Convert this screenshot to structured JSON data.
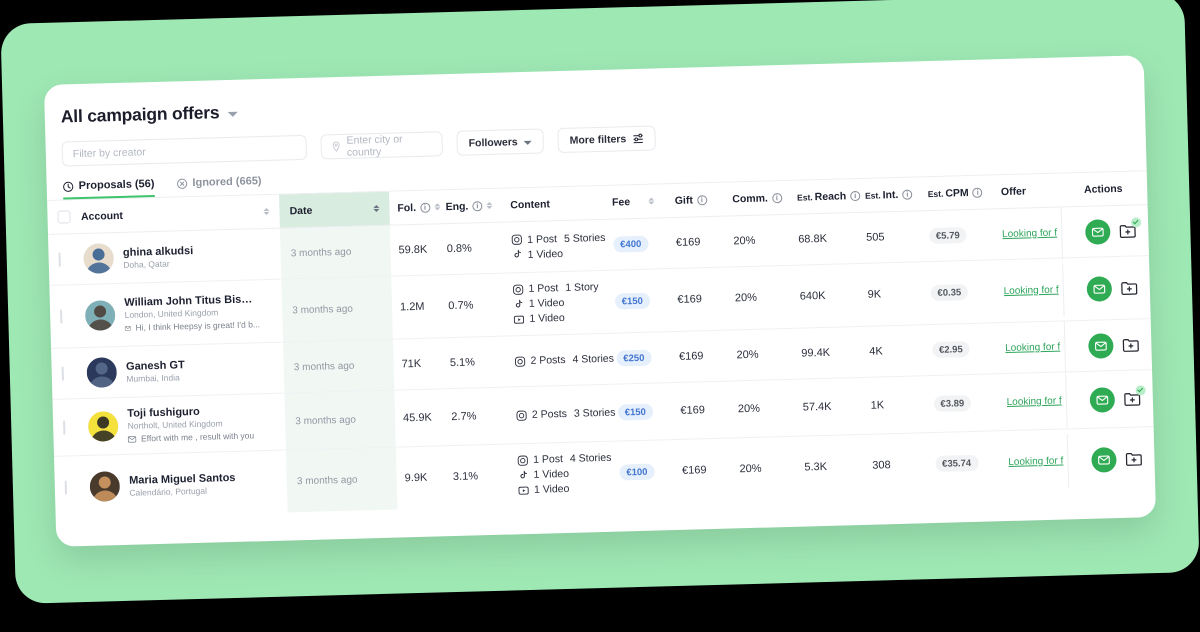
{
  "header": {
    "title": "All campaign offers",
    "dropdown_icon": "chevron-down-icon"
  },
  "filters": {
    "creator_placeholder": "Filter by creator",
    "creator_value": "",
    "location_placeholder": "Enter city or country",
    "location_value": "",
    "location_icon": "location-pin-icon",
    "followers_label": "Followers",
    "more_filters_label": "More filters",
    "more_filters_icon": "sliders-icon"
  },
  "tabs": [
    {
      "label": "Proposals (56)",
      "icon": "clock-icon",
      "active": true
    },
    {
      "label": "Ignored (665)",
      "icon": "circle-x-icon",
      "active": false
    }
  ],
  "table": {
    "columns": [
      {
        "key": "checkbox",
        "label": ""
      },
      {
        "key": "account",
        "label": "Account",
        "sortable": true
      },
      {
        "key": "date",
        "label": "Date",
        "sortable": true,
        "highlight": true
      },
      {
        "key": "fol",
        "label": "Fol.",
        "info": true,
        "sortable": true
      },
      {
        "key": "eng",
        "label": "Eng.",
        "info": true,
        "sortable": true
      },
      {
        "key": "content",
        "label": "Content"
      },
      {
        "key": "fee",
        "label": "Fee",
        "sortable": true
      },
      {
        "key": "gift",
        "label": "Gift",
        "info": true
      },
      {
        "key": "comm",
        "label": "Comm.",
        "info": true
      },
      {
        "key": "reach",
        "label": "Est. Reach",
        "info": true,
        "small_prefix": "Est."
      },
      {
        "key": "int",
        "label": "Est. Int.",
        "info": true,
        "small_prefix": "Est."
      },
      {
        "key": "cpm",
        "label": "Est. CPM",
        "info": true,
        "small_prefix": "Est."
      },
      {
        "key": "offer",
        "label": "Offer"
      },
      {
        "key": "actions",
        "label": "Actions"
      }
    ],
    "rows": [
      {
        "name": "ghina alkudsi",
        "location": "Doha, Qatar",
        "message": "",
        "avatar_colors": [
          "#e8ddcc",
          "#2c5a8e"
        ],
        "date": "3 months ago",
        "fol": "59.8K",
        "eng": "0.8%",
        "content": [
          {
            "icon": "instagram-icon",
            "items": [
              "1 Post",
              "5 Stories"
            ]
          },
          {
            "icon": "tiktok-icon",
            "items": [
              "1 Video"
            ]
          }
        ],
        "fee": "€400",
        "gift": "€169",
        "comm": "20%",
        "reach": "68.8K",
        "int": "505",
        "cpm": "€5.79",
        "offer": "Looking for f",
        "folder_checked": true
      },
      {
        "name": "William John Titus Bish...",
        "location": "London, United Kingdom",
        "message": "Hi, I think Heepsy is great! I'd b...",
        "avatar_colors": [
          "#7fb0b8",
          "#4a3a30"
        ],
        "date": "3 months ago",
        "fol": "1.2M",
        "eng": "0.7%",
        "content": [
          {
            "icon": "instagram-icon",
            "items": [
              "1 Post",
              "1 Story"
            ]
          },
          {
            "icon": "tiktok-icon",
            "items": [
              "1 Video"
            ]
          },
          {
            "icon": "youtube-icon",
            "items": [
              "1 Video"
            ]
          }
        ],
        "fee": "€150",
        "gift": "€169",
        "comm": "20%",
        "reach": "640K",
        "int": "9K",
        "cpm": "€0.35",
        "offer": "Looking for f",
        "folder_checked": false
      },
      {
        "name": "Ganesh GT",
        "location": "Mumbai, India",
        "message": "",
        "avatar_colors": [
          "#2b3a5c",
          "#5c6f8f"
        ],
        "date": "3 months ago",
        "fol": "71K",
        "eng": "5.1%",
        "content": [
          {
            "icon": "instagram-icon",
            "items": [
              "2 Posts",
              "4 Stories"
            ]
          }
        ],
        "fee": "€250",
        "gift": "€169",
        "comm": "20%",
        "reach": "99.4K",
        "int": "4K",
        "cpm": "€2.95",
        "offer": "Looking for f",
        "folder_checked": false
      },
      {
        "name": "Toji fushiguro",
        "location": "Northolt, United Kingdom",
        "message": "Effort with me , result with you",
        "avatar_colors": [
          "#f5e13c",
          "#1a1a22"
        ],
        "date": "3 months ago",
        "fol": "45.9K",
        "eng": "2.7%",
        "content": [
          {
            "icon": "instagram-icon",
            "items": [
              "2 Posts",
              "3 Stories"
            ]
          }
        ],
        "fee": "€150",
        "gift": "€169",
        "comm": "20%",
        "reach": "57.4K",
        "int": "1K",
        "cpm": "€3.89",
        "offer": "Looking for f",
        "folder_checked": true
      },
      {
        "name": "Maria Miguel Santos",
        "location": "Calendário, Portugal",
        "message": "",
        "avatar_colors": [
          "#4a3a2c",
          "#d9a066"
        ],
        "date": "3 months ago",
        "fol": "9.9K",
        "eng": "3.1%",
        "content": [
          {
            "icon": "instagram-icon",
            "items": [
              "1 Post",
              "4 Stories"
            ]
          },
          {
            "icon": "tiktok-icon",
            "items": [
              "1 Video"
            ]
          },
          {
            "icon": "youtube-icon",
            "items": [
              "1 Video"
            ]
          }
        ],
        "fee": "€100",
        "gift": "€169",
        "comm": "20%",
        "reach": "5.3K",
        "int": "308",
        "cpm": "€35.74",
        "offer": "Looking for f",
        "folder_checked": false
      }
    ]
  },
  "action_icons": {
    "message": "envelope-icon",
    "folder": "folder-add-icon",
    "dismiss": "circle-x-icon"
  },
  "colors": {
    "brand_green": "#2fab54",
    "panel_green": "#9ee8b4",
    "tab_underline": "#3ec46d",
    "fee_badge_bg": "#e6effc",
    "fee_badge_text": "#4276d0",
    "date_header_bg": "#d9ece0",
    "date_cell_bg": "#f1f8f4"
  }
}
